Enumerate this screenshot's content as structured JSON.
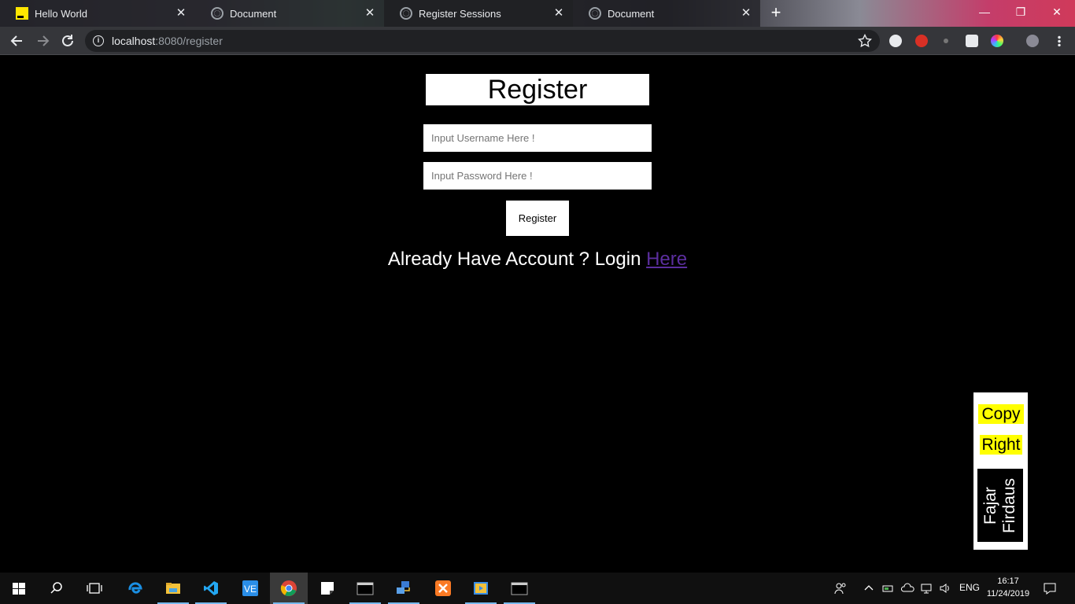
{
  "browser": {
    "tabs": [
      {
        "title": "Hello World",
        "favicon": "yellow-logo-icon",
        "active": false
      },
      {
        "title": "Document",
        "favicon": "globe-icon",
        "active": false
      },
      {
        "title": "Register Sessions",
        "favicon": "globe-icon",
        "active": true
      },
      {
        "title": "Document",
        "favicon": "globe-icon",
        "active": false
      }
    ],
    "new_tab": "+",
    "window_controls": {
      "minimize": "—",
      "restore": "❐",
      "close": "✕"
    },
    "url_host": "localhost",
    "url_rest": ":8080/register"
  },
  "page": {
    "title": "Register",
    "username_placeholder": "Input Username Here !",
    "password_placeholder": "Input Password Here !",
    "register_button": "Register",
    "login_prompt": "Already Have Account ? Login ",
    "login_link": "Here",
    "copyright": {
      "copy": "Copy",
      "right": "Right",
      "name": "Fajar Firdaus"
    }
  },
  "taskbar": {
    "language": "ENG",
    "time": "16:17",
    "date": "11/24/2019"
  },
  "colors": {
    "page_bg": "#000000",
    "link": "#5b2e9e",
    "highlight": "#ffff00",
    "tab_active": "#202124",
    "toolbar": "#35363a"
  }
}
